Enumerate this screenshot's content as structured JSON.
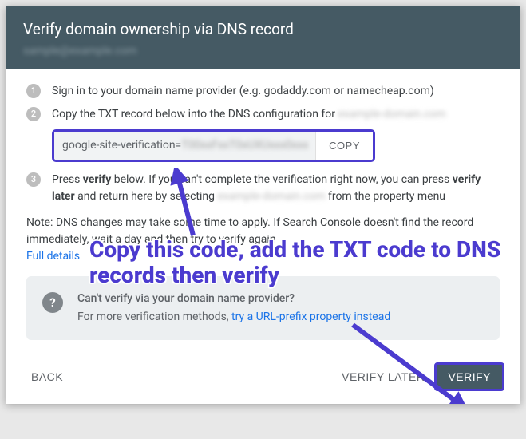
{
  "header": {
    "title": "Verify domain ownership via DNS record",
    "subtitle": "sample@example.com"
  },
  "steps": {
    "s1": {
      "num": "1",
      "text": "Sign in to your domain name provider (e.g. godaddy.com or namecheap.com)"
    },
    "s2": {
      "num": "2",
      "text_a": "Copy the TXT record below into the DNS configuration for ",
      "text_b": "example-domain.com"
    },
    "s3": {
      "num": "3",
      "t1": "Press ",
      "b1": "verify",
      "t2": " below. If you can't complete the verification right now, you can press ",
      "b2": "verify later",
      "t3": " and return here by selecting ",
      "blur": "example-domain.com",
      "t4": " from the property menu"
    }
  },
  "record": {
    "prefix": "google-site-verification=",
    "rest": "T00xxFxxT0xUXUxxx0xxx",
    "copy": "COPY"
  },
  "note": {
    "t1": "Note: DNS changes may take some time to apply. If Search Console doesn't find the record immediately, wait a day and then try to verify again",
    "link": "Full details"
  },
  "info": {
    "icon": "?",
    "title": "Can't verify via your domain name provider?",
    "sub_a": "For more verification methods, ",
    "sub_link": "try a URL-prefix property instead"
  },
  "footer": {
    "back": "BACK",
    "verify_later": "VERIFY LATER",
    "verify": "VERIFY"
  },
  "annotation": "Copy this code, add the TXT code to DNS records then verify"
}
